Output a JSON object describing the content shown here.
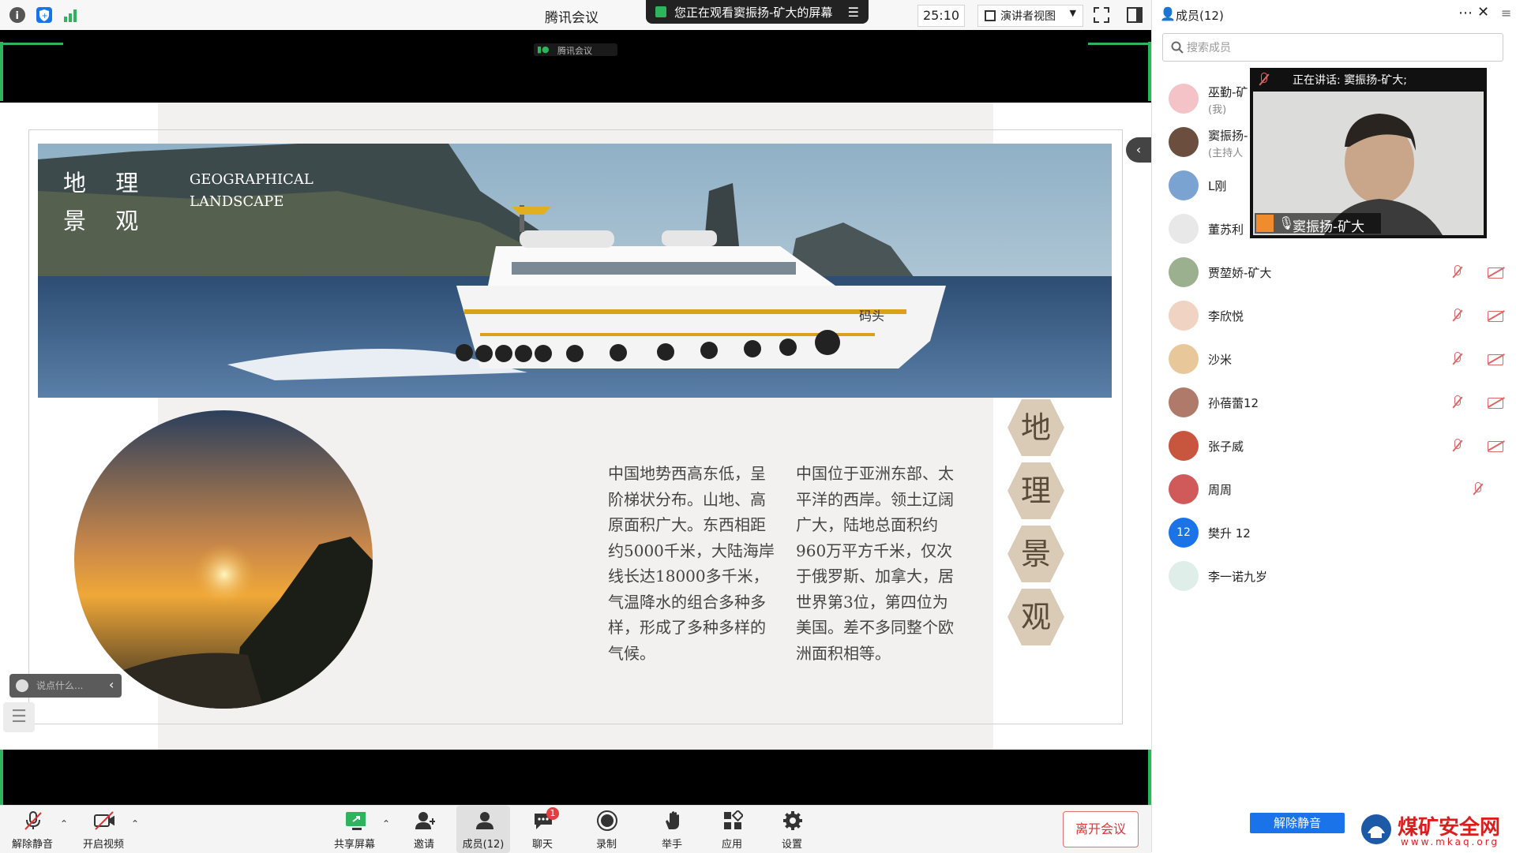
{
  "window": {
    "title": "腾讯会议",
    "banner": "您正在观看窦振扬-矿大的屏幕",
    "timer": "25:10",
    "view_mode": "演讲者视图"
  },
  "stage": {
    "watermark": "腾讯会议",
    "slide": {
      "heading_cn": "地 理\n景 观",
      "heading_en": "GEOGRAPHICAL\nLANDSCAPE",
      "para1": "中国地势西高东低，呈阶梯状分布。山地、高原面积广大。东西相距约5000千米，大陆海岸线长达18000多千米，气温降水的组合多种多样，形成了多种多样的气候。",
      "para2": "中国位于亚洲东部、太平洋的西岸。领土辽阔广大，陆地总面积约960万平方千米，仅次于俄罗斯、加拿大，居世界第3位，第四位为美国。差不多同整个欧洲面积相等。",
      "hex_chars": [
        "地",
        "理",
        "景",
        "观"
      ],
      "boat_text": "码头"
    },
    "chat_placeholder": "说点什么..."
  },
  "toolbar": {
    "items": [
      {
        "label": "解除静音",
        "icon": "mic-muted-icon"
      },
      {
        "label": "开启视频",
        "icon": "video-off-icon"
      },
      {
        "label": "共享屏幕",
        "icon": "share-screen-icon"
      },
      {
        "label": "邀请",
        "icon": "invite-icon"
      },
      {
        "label": "成员(12)",
        "icon": "members-icon"
      },
      {
        "label": "聊天",
        "icon": "chat-icon"
      },
      {
        "label": "录制",
        "icon": "record-icon"
      },
      {
        "label": "举手",
        "icon": "hand-icon"
      },
      {
        "label": "应用",
        "icon": "apps-icon"
      },
      {
        "label": "设置",
        "icon": "gear-icon"
      }
    ],
    "chat_badge": "1",
    "leave": "离开会议"
  },
  "panel": {
    "title": "成员(12)",
    "search_placeholder": "搜索成员",
    "members": [
      {
        "name": "巫勤-矿",
        "sub": "(我)",
        "avatar": "#f4c3c8"
      },
      {
        "name": "窦振扬-",
        "sub": "(主持人",
        "avatar": "#6b4e3d"
      },
      {
        "name": "L刚",
        "sub": "",
        "avatar": "#7aa3d1"
      },
      {
        "name": "董苏利",
        "sub": "",
        "avatar": "#e8e8e8"
      },
      {
        "name": "贾堃娇-矿大",
        "sub": "",
        "avatar": "#9bb08f"
      },
      {
        "name": "李欣悦",
        "sub": "",
        "avatar": "#f0d3c2"
      },
      {
        "name": "沙米",
        "sub": "",
        "avatar": "#e8c89a"
      },
      {
        "name": "孙蓓蕾12",
        "sub": "",
        "avatar": "#b07a6a"
      },
      {
        "name": "张子威",
        "sub": "",
        "avatar": "#c8553d"
      },
      {
        "name": "周周",
        "sub": "",
        "avatar": "#d05a5a"
      },
      {
        "name": "樊升 12",
        "sub": "",
        "avatar": "#1a73e8",
        "initial": "12"
      },
      {
        "name": "李一诺九岁",
        "sub": "",
        "avatar": "#dfeee8"
      }
    ],
    "speaking": "正在讲话: 窦振扬-矿大;",
    "speaker_name": "窦振扬-矿大",
    "unmute_all": "解除静音"
  },
  "logo": {
    "title": "煤矿安全网",
    "url": "www.mkaq.org"
  }
}
